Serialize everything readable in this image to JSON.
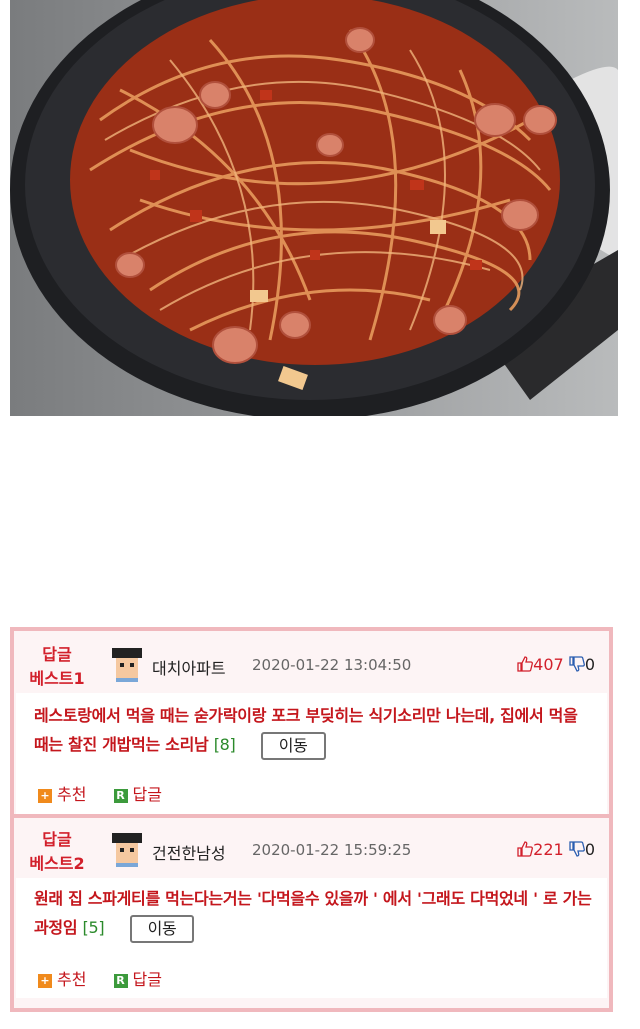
{
  "comments": [
    {
      "badge_line1": "답글",
      "badge_line2": "베스트1",
      "nickname": "대치아파트",
      "date": "2020-01-22 13:04:50",
      "up": "407",
      "down": "0",
      "text": "레스토랑에서 먹을 때는 숟가락이랑 포크 부딪히는 식기소리만 나는데, 집에서 먹을 때는 찰진 개밥먹는 소리남",
      "reply_count": "[8]",
      "move_label": "이동",
      "recommend_label": "추천",
      "reply_label": "답글"
    },
    {
      "badge_line1": "답글",
      "badge_line2": "베스트2",
      "nickname": "건전한남성",
      "date": "2020-01-22 15:59:25",
      "up": "221",
      "down": "0",
      "text": "원래 집 스파게티를 먹는다는거는 '다먹을수 있을까 ' 에서 '그래도 다먹었네 ' 로 가는 과정임",
      "reply_count": "[5]",
      "move_label": "이동",
      "recommend_label": "추천",
      "reply_label": "답글"
    }
  ],
  "icons": {
    "up": "thumbs-up-icon",
    "down": "thumbs-down-icon",
    "recommend": "plus-square-icon",
    "reply": "r-square-icon"
  },
  "colors": {
    "accent_red": "#c4161c",
    "border_pink": "#f0b8bd",
    "count_green": "#2b8a2b"
  }
}
